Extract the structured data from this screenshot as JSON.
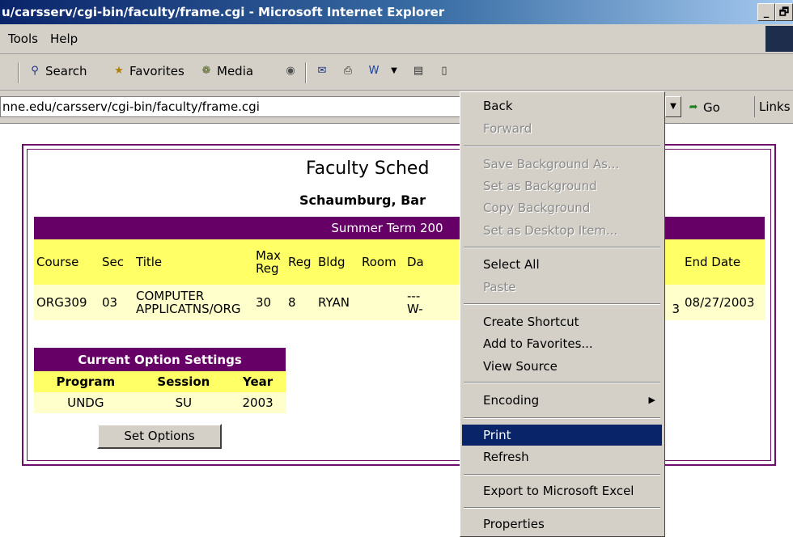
{
  "window": {
    "title": "u/carsserv/cgi-bin/faculty/frame.cgi - Microsoft Internet Explorer",
    "min": "_",
    "max": "🗗"
  },
  "menubar": {
    "items": [
      "Tools",
      "Help"
    ]
  },
  "toolbar": {
    "search": "Search",
    "favorites": "Favorites",
    "media": "Media"
  },
  "address": {
    "url": "nne.edu/carsserv/cgi-bin/faculty/frame.cgi",
    "go": "Go",
    "links": "Links"
  },
  "page": {
    "title": "Faculty Sched",
    "subtitle": "Schaumburg, Bar",
    "term": "Summer Term 200",
    "table": {
      "headers": [
        "Course",
        "Sec",
        "Title",
        "Max Reg",
        "Reg",
        "Bldg",
        "Room",
        "Da",
        "End Date"
      ],
      "row": {
        "course": "ORG309",
        "sec": "03",
        "title": "COMPUTER APPLICATNS/ORG",
        "max": "30",
        "reg": "8",
        "bldg": "RYAN",
        "room": "",
        "days_top": "---",
        "days_bot": "W-",
        "cut": "3",
        "end": "08/27/2003"
      }
    },
    "options": {
      "caption": "Current Option Settings",
      "headers": [
        "Program",
        "Session",
        "Year"
      ],
      "values": [
        "UNDG",
        "SU",
        "2003"
      ],
      "button": "Set Options"
    }
  },
  "context_menu": {
    "items": [
      {
        "label": "Back",
        "disabled": false
      },
      {
        "label": "Forward",
        "disabled": true
      },
      {
        "label": "Save Background As...",
        "disabled": true
      },
      {
        "label": "Set as Background",
        "disabled": true
      },
      {
        "label": "Copy Background",
        "disabled": true
      },
      {
        "label": "Set as Desktop Item...",
        "disabled": true
      },
      {
        "label": "Select All",
        "disabled": false
      },
      {
        "label": "Paste",
        "disabled": true
      },
      {
        "label": "Create Shortcut",
        "disabled": false
      },
      {
        "label": "Add to Favorites...",
        "disabled": false
      },
      {
        "label": "View Source",
        "disabled": false
      },
      {
        "label": "Encoding",
        "disabled": false,
        "submenu": true
      },
      {
        "label": "Print",
        "disabled": false,
        "selected": true
      },
      {
        "label": "Refresh",
        "disabled": false
      },
      {
        "label": "Export to Microsoft Excel",
        "disabled": false
      },
      {
        "label": "Properties",
        "disabled": false
      }
    ]
  },
  "colors": {
    "purple": "#660066",
    "header_yellow": "#ffff66",
    "row_yellow": "#ffffcc",
    "highlight": "#0a246a"
  }
}
